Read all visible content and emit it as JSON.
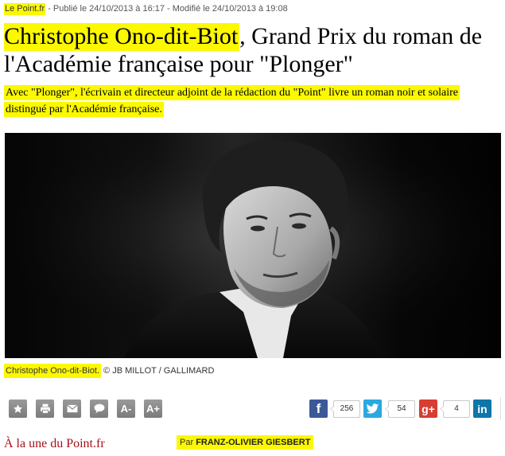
{
  "meta": {
    "source": "Le Point.fr",
    "published": " - Publié le 24/10/2013 à 16:17 - Modifié le 24/10/2013 à 19:08"
  },
  "headline": {
    "highlighted": "Christophe Ono-dit-Biot",
    "rest": ", Grand Prix du roman de l'Académie française pour \"Plonger\""
  },
  "lead": {
    "text": "Avec \"Plonger\", l'écrivain et directeur adjoint de la rédaction du \"Point\" livre un roman noir et solaire distingué par l'Académie française."
  },
  "caption": {
    "name": "Christophe Ono-dit-Biot.",
    "credit": " © JB MILLOT / GALLIMARD"
  },
  "toolbar": {
    "icons": [
      "star-icon",
      "print-icon",
      "email-icon",
      "comment-icon",
      "decrease-font-icon",
      "increase-font-icon"
    ],
    "font_smaller": "A-",
    "font_larger": "A+"
  },
  "share": {
    "facebook": {
      "glyph": "f",
      "count": "256",
      "color": "#3b5998"
    },
    "twitter": {
      "count": "54",
      "color": "#2aa9e0"
    },
    "googleplus": {
      "glyph": "g+",
      "count": "4",
      "color": "#d73d32"
    },
    "linkedin": {
      "glyph": "in",
      "color": "#0e76a8"
    }
  },
  "footer": {
    "rubric": "À la une du Point.fr",
    "byline_prefix": "Par ",
    "author": "FRANZ-OLIVIER GIESBERT"
  },
  "colors": {
    "highlight": "#fbf800",
    "rubric": "#a4111a",
    "tool_grey": "#8a8a8a"
  }
}
